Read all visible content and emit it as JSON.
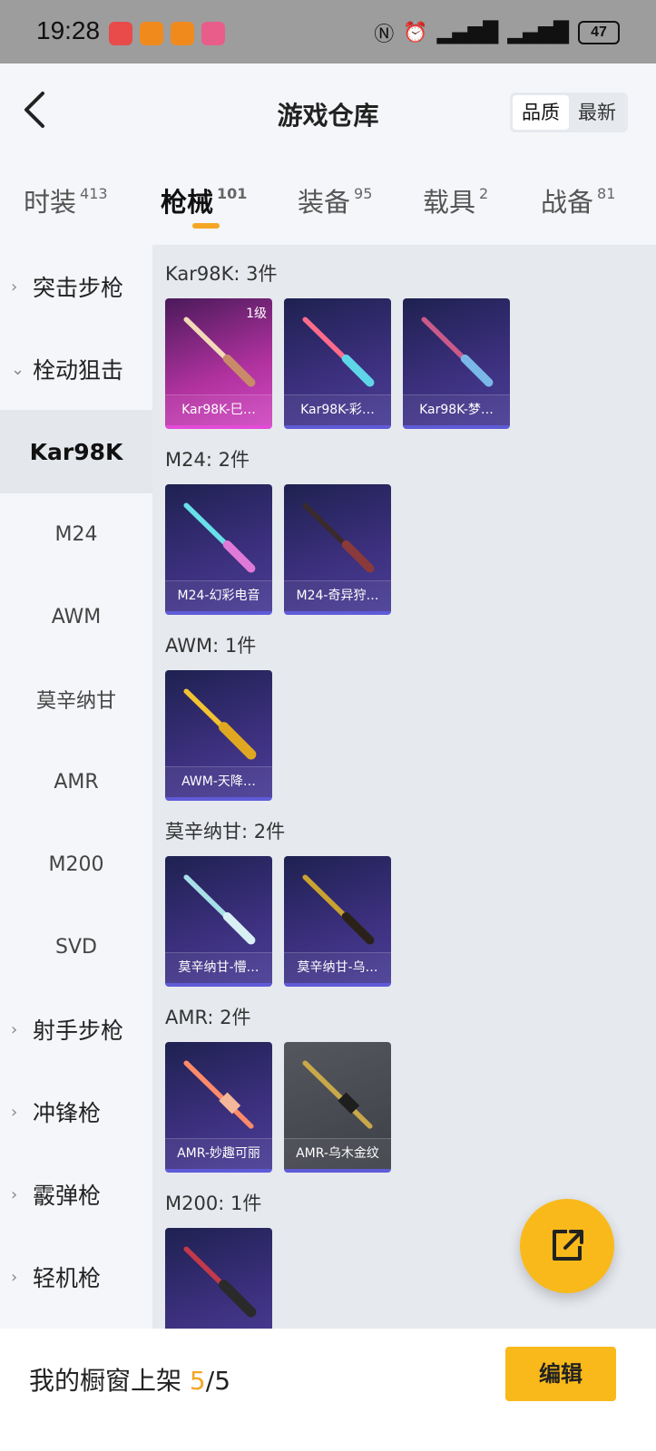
{
  "status_bar": {
    "time": "19:28",
    "battery": "47",
    "icons": [
      "nfc-icon",
      "alarm-icon",
      "signal-icon",
      "signal-icon"
    ]
  },
  "header": {
    "title": "游戏仓库",
    "sort_options": [
      "品质",
      "最新"
    ],
    "active_sort": "品质"
  },
  "tabs": [
    {
      "label": "时装",
      "count": "413"
    },
    {
      "label": "枪械",
      "count": "101",
      "active": true
    },
    {
      "label": "装备",
      "count": "95"
    },
    {
      "label": "载具",
      "count": "2"
    },
    {
      "label": "战备",
      "count": "81"
    }
  ],
  "sidebar": {
    "items": [
      {
        "label": "突击步枪",
        "type": "group",
        "expanded": false
      },
      {
        "label": "栓动狙击",
        "type": "group",
        "expanded": true
      },
      {
        "label": "Kar98K",
        "type": "sub",
        "active": true
      },
      {
        "label": "M24",
        "type": "sub"
      },
      {
        "label": "AWM",
        "type": "sub"
      },
      {
        "label": "莫辛纳甘",
        "type": "sub"
      },
      {
        "label": "AMR",
        "type": "sub"
      },
      {
        "label": "M200",
        "type": "sub"
      },
      {
        "label": "SVD",
        "type": "sub"
      },
      {
        "label": "射手步枪",
        "type": "group",
        "expanded": false
      },
      {
        "label": "冲锋枪",
        "type": "group",
        "expanded": false
      },
      {
        "label": "霰弹枪",
        "type": "group",
        "expanded": false
      },
      {
        "label": "轻机枪",
        "type": "group",
        "expanded": false
      }
    ]
  },
  "sections": [
    {
      "title": "Kar98K: 3件",
      "items": [
        {
          "name": "Kar98K-巳…",
          "level": "1级",
          "style": "pink"
        },
        {
          "name": "Kar98K-彩…",
          "style": "purple"
        },
        {
          "name": "Kar98K-梦…",
          "style": "purple"
        }
      ]
    },
    {
      "title": "M24: 2件",
      "items": [
        {
          "name": "M24-幻彩电音",
          "style": "purple"
        },
        {
          "name": "M24-奇异狩…",
          "style": "purple"
        }
      ]
    },
    {
      "title": "AWM: 1件",
      "items": [
        {
          "name": "AWM-天降…",
          "style": "purple"
        }
      ]
    },
    {
      "title": "莫辛纳甘: 2件",
      "items": [
        {
          "name": "莫辛纳甘-懵…",
          "style": "purple"
        },
        {
          "name": "莫辛纳甘-乌…",
          "style": "purple"
        }
      ]
    },
    {
      "title": "AMR: 2件",
      "items": [
        {
          "name": "AMR-妙趣可丽",
          "style": "purple"
        },
        {
          "name": "AMR-乌木金纹",
          "style": "gray"
        }
      ]
    },
    {
      "title": "M200: 1件",
      "items": [
        {
          "name": "",
          "style": "purple"
        }
      ]
    }
  ],
  "bottom_bar": {
    "label": "我的橱窗上架",
    "current": "5",
    "separator": "/",
    "total": "5",
    "edit_label": "编辑"
  },
  "colors": {
    "accent": "#f9b91a",
    "highlight": "#f5a623",
    "card_border": "#5f5bd8",
    "card_pink": "#d14ac3"
  }
}
